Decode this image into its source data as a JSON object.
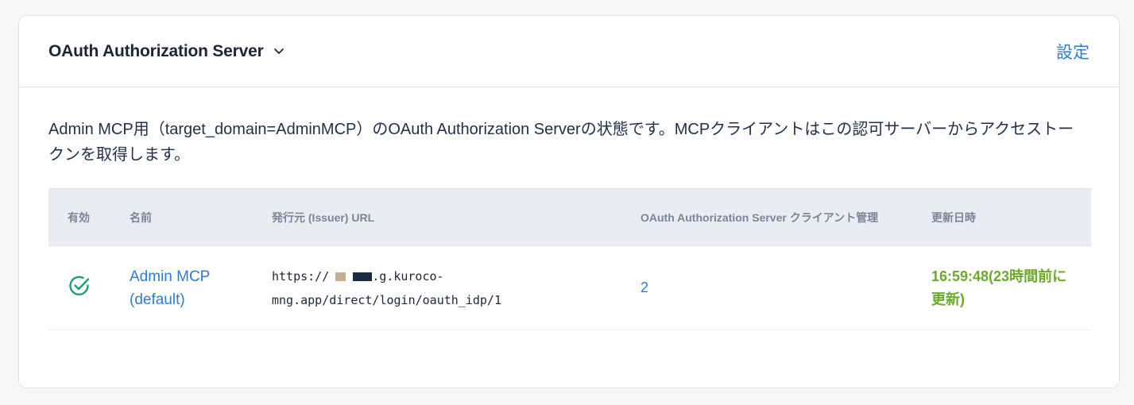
{
  "header": {
    "title": "OAuth Authorization Server",
    "settings_label": "設定"
  },
  "description": "Admin MCP用（target_domain=AdminMCP）のOAuth Authorization Serverの状態です。MCPクライアントはこの認可サーバーからアクセストークンを取得します。",
  "table": {
    "columns": [
      "有効",
      "名前",
      "発行元 (Issuer) URL",
      "OAuth Authorization Server クライアント管理",
      "更新日時"
    ],
    "rows": [
      {
        "enabled": true,
        "name": "Admin MCP (default)",
        "issuer_prefix": "https://",
        "issuer_suffix": ".g.kuroco-mng.app/direct/login/oauth_idp/1",
        "client_count": "2",
        "updated": "16:59:48(23時間前に更新)"
      }
    ]
  },
  "colors": {
    "link": "#2e7bd4",
    "success": "#22a06b",
    "updated": "#6aaa2c",
    "header_bg": "#e8edf4"
  },
  "icons": {
    "title_chevron": "chevron-down-icon",
    "enabled": "check-circle-icon"
  }
}
